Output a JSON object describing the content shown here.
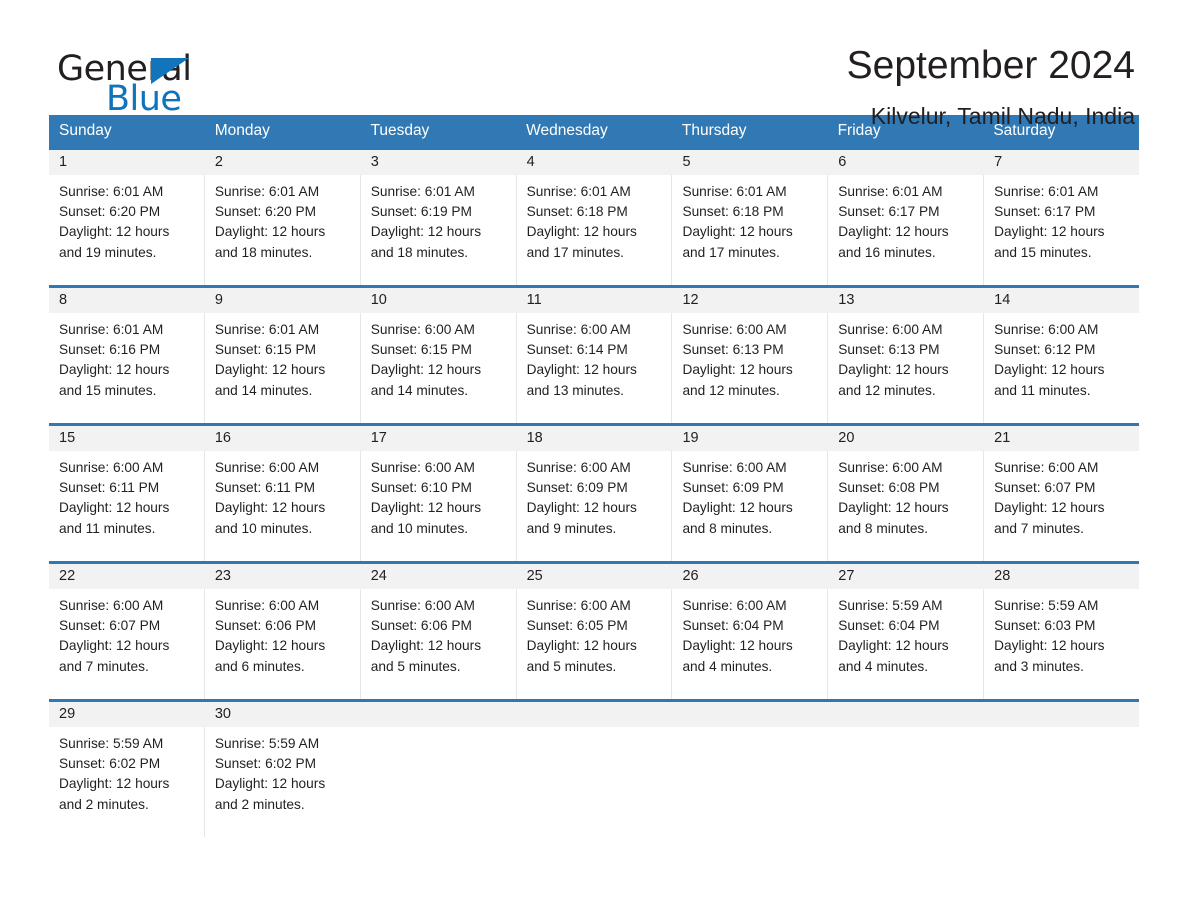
{
  "brand": {
    "name_part1": "General",
    "name_part2": "Blue",
    "triangle_icon": "logo-triangle-icon",
    "accent_color": "#0f74bb"
  },
  "header": {
    "title": "September 2024",
    "location": "Kilvelur, Tamil Nadu, India"
  },
  "colors": {
    "header_bar": "#3079b5",
    "week_divider": "#2f78b4",
    "date_band": "#f2f2f2",
    "text": "#231f20"
  },
  "weekdays": [
    "Sunday",
    "Monday",
    "Tuesday",
    "Wednesday",
    "Thursday",
    "Friday",
    "Saturday"
  ],
  "weeks": [
    {
      "dates": [
        "1",
        "2",
        "3",
        "4",
        "5",
        "6",
        "7"
      ],
      "cells": [
        {
          "sunrise": "Sunrise: 6:01 AM",
          "sunset": "Sunset: 6:20 PM",
          "daylight1": "Daylight: 12 hours",
          "daylight2": "and 19 minutes."
        },
        {
          "sunrise": "Sunrise: 6:01 AM",
          "sunset": "Sunset: 6:20 PM",
          "daylight1": "Daylight: 12 hours",
          "daylight2": "and 18 minutes."
        },
        {
          "sunrise": "Sunrise: 6:01 AM",
          "sunset": "Sunset: 6:19 PM",
          "daylight1": "Daylight: 12 hours",
          "daylight2": "and 18 minutes."
        },
        {
          "sunrise": "Sunrise: 6:01 AM",
          "sunset": "Sunset: 6:18 PM",
          "daylight1": "Daylight: 12 hours",
          "daylight2": "and 17 minutes."
        },
        {
          "sunrise": "Sunrise: 6:01 AM",
          "sunset": "Sunset: 6:18 PM",
          "daylight1": "Daylight: 12 hours",
          "daylight2": "and 17 minutes."
        },
        {
          "sunrise": "Sunrise: 6:01 AM",
          "sunset": "Sunset: 6:17 PM",
          "daylight1": "Daylight: 12 hours",
          "daylight2": "and 16 minutes."
        },
        {
          "sunrise": "Sunrise: 6:01 AM",
          "sunset": "Sunset: 6:17 PM",
          "daylight1": "Daylight: 12 hours",
          "daylight2": "and 15 minutes."
        }
      ]
    },
    {
      "dates": [
        "8",
        "9",
        "10",
        "11",
        "12",
        "13",
        "14"
      ],
      "cells": [
        {
          "sunrise": "Sunrise: 6:01 AM",
          "sunset": "Sunset: 6:16 PM",
          "daylight1": "Daylight: 12 hours",
          "daylight2": "and 15 minutes."
        },
        {
          "sunrise": "Sunrise: 6:01 AM",
          "sunset": "Sunset: 6:15 PM",
          "daylight1": "Daylight: 12 hours",
          "daylight2": "and 14 minutes."
        },
        {
          "sunrise": "Sunrise: 6:00 AM",
          "sunset": "Sunset: 6:15 PM",
          "daylight1": "Daylight: 12 hours",
          "daylight2": "and 14 minutes."
        },
        {
          "sunrise": "Sunrise: 6:00 AM",
          "sunset": "Sunset: 6:14 PM",
          "daylight1": "Daylight: 12 hours",
          "daylight2": "and 13 minutes."
        },
        {
          "sunrise": "Sunrise: 6:00 AM",
          "sunset": "Sunset: 6:13 PM",
          "daylight1": "Daylight: 12 hours",
          "daylight2": "and 12 minutes."
        },
        {
          "sunrise": "Sunrise: 6:00 AM",
          "sunset": "Sunset: 6:13 PM",
          "daylight1": "Daylight: 12 hours",
          "daylight2": "and 12 minutes."
        },
        {
          "sunrise": "Sunrise: 6:00 AM",
          "sunset": "Sunset: 6:12 PM",
          "daylight1": "Daylight: 12 hours",
          "daylight2": "and 11 minutes."
        }
      ]
    },
    {
      "dates": [
        "15",
        "16",
        "17",
        "18",
        "19",
        "20",
        "21"
      ],
      "cells": [
        {
          "sunrise": "Sunrise: 6:00 AM",
          "sunset": "Sunset: 6:11 PM",
          "daylight1": "Daylight: 12 hours",
          "daylight2": "and 11 minutes."
        },
        {
          "sunrise": "Sunrise: 6:00 AM",
          "sunset": "Sunset: 6:11 PM",
          "daylight1": "Daylight: 12 hours",
          "daylight2": "and 10 minutes."
        },
        {
          "sunrise": "Sunrise: 6:00 AM",
          "sunset": "Sunset: 6:10 PM",
          "daylight1": "Daylight: 12 hours",
          "daylight2": "and 10 minutes."
        },
        {
          "sunrise": "Sunrise: 6:00 AM",
          "sunset": "Sunset: 6:09 PM",
          "daylight1": "Daylight: 12 hours",
          "daylight2": "and 9 minutes."
        },
        {
          "sunrise": "Sunrise: 6:00 AM",
          "sunset": "Sunset: 6:09 PM",
          "daylight1": "Daylight: 12 hours",
          "daylight2": "and 8 minutes."
        },
        {
          "sunrise": "Sunrise: 6:00 AM",
          "sunset": "Sunset: 6:08 PM",
          "daylight1": "Daylight: 12 hours",
          "daylight2": "and 8 minutes."
        },
        {
          "sunrise": "Sunrise: 6:00 AM",
          "sunset": "Sunset: 6:07 PM",
          "daylight1": "Daylight: 12 hours",
          "daylight2": "and 7 minutes."
        }
      ]
    },
    {
      "dates": [
        "22",
        "23",
        "24",
        "25",
        "26",
        "27",
        "28"
      ],
      "cells": [
        {
          "sunrise": "Sunrise: 6:00 AM",
          "sunset": "Sunset: 6:07 PM",
          "daylight1": "Daylight: 12 hours",
          "daylight2": "and 7 minutes."
        },
        {
          "sunrise": "Sunrise: 6:00 AM",
          "sunset": "Sunset: 6:06 PM",
          "daylight1": "Daylight: 12 hours",
          "daylight2": "and 6 minutes."
        },
        {
          "sunrise": "Sunrise: 6:00 AM",
          "sunset": "Sunset: 6:06 PM",
          "daylight1": "Daylight: 12 hours",
          "daylight2": "and 5 minutes."
        },
        {
          "sunrise": "Sunrise: 6:00 AM",
          "sunset": "Sunset: 6:05 PM",
          "daylight1": "Daylight: 12 hours",
          "daylight2": "and 5 minutes."
        },
        {
          "sunrise": "Sunrise: 6:00 AM",
          "sunset": "Sunset: 6:04 PM",
          "daylight1": "Daylight: 12 hours",
          "daylight2": "and 4 minutes."
        },
        {
          "sunrise": "Sunrise: 5:59 AM",
          "sunset": "Sunset: 6:04 PM",
          "daylight1": "Daylight: 12 hours",
          "daylight2": "and 4 minutes."
        },
        {
          "sunrise": "Sunrise: 5:59 AM",
          "sunset": "Sunset: 6:03 PM",
          "daylight1": "Daylight: 12 hours",
          "daylight2": "and 3 minutes."
        }
      ]
    },
    {
      "dates": [
        "29",
        "30",
        "",
        "",
        "",
        "",
        ""
      ],
      "cells": [
        {
          "sunrise": "Sunrise: 5:59 AM",
          "sunset": "Sunset: 6:02 PM",
          "daylight1": "Daylight: 12 hours",
          "daylight2": "and 2 minutes."
        },
        {
          "sunrise": "Sunrise: 5:59 AM",
          "sunset": "Sunset: 6:02 PM",
          "daylight1": "Daylight: 12 hours",
          "daylight2": "and 2 minutes."
        },
        {
          "sunrise": "",
          "sunset": "",
          "daylight1": "",
          "daylight2": ""
        },
        {
          "sunrise": "",
          "sunset": "",
          "daylight1": "",
          "daylight2": ""
        },
        {
          "sunrise": "",
          "sunset": "",
          "daylight1": "",
          "daylight2": ""
        },
        {
          "sunrise": "",
          "sunset": "",
          "daylight1": "",
          "daylight2": ""
        },
        {
          "sunrise": "",
          "sunset": "",
          "daylight1": "",
          "daylight2": ""
        }
      ]
    }
  ]
}
